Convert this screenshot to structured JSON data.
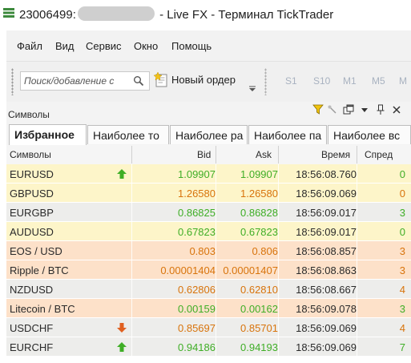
{
  "window": {
    "title_prefix": "23006499:",
    "title_suffix": "- Live FX - Терминал TickTrader"
  },
  "menu": [
    "Файл",
    "Вид",
    "Сервис",
    "Окно",
    "Помощь"
  ],
  "toolbar": {
    "search_placeholder": "Поиск/добавление с",
    "new_order_label": "Новый ордер",
    "timeframes": [
      "S1",
      "S10",
      "M1",
      "M5",
      "M"
    ]
  },
  "panel": {
    "title": "Символы"
  },
  "tabs": [
    "Избранное",
    "Наиболее то",
    "Наиболее ра",
    "Наиболее па",
    "Наиболее вс"
  ],
  "columns": {
    "symbol": "Символы",
    "bid": "Bid",
    "ask": "Ask",
    "time": "Время",
    "spread": "Спред"
  },
  "colors": {
    "row_yellow": "#fdf5c9",
    "row_orange": "#fde1c9",
    "row_gray": "#ededeb",
    "green": "#3fae26",
    "orange": "#d8740c",
    "up_arrow": "#3fae26",
    "down_arrow": "#e06020"
  },
  "rows": [
    {
      "symbol": "EURUSD",
      "bid": "1.09907",
      "ask": "1.09907",
      "time": "18:56:08.760",
      "spread": "0",
      "bg": "yellow",
      "tone": "green",
      "arrow": "up"
    },
    {
      "symbol": "GBPUSD",
      "bid": "1.26580",
      "ask": "1.26580",
      "time": "18:56:09.069",
      "spread": "0",
      "bg": "yellow",
      "tone": "orange",
      "arrow": ""
    },
    {
      "symbol": "EURGBP",
      "bid": "0.86825",
      "ask": "0.86828",
      "time": "18:56:09.017",
      "spread": "3",
      "bg": "gray",
      "tone": "green",
      "arrow": ""
    },
    {
      "symbol": "AUDUSD",
      "bid": "0.67823",
      "ask": "0.67823",
      "time": "18:56:09.017",
      "spread": "0",
      "bg": "yellow",
      "tone": "green",
      "arrow": ""
    },
    {
      "symbol": "EOS / USD",
      "bid": "0.803",
      "ask": "0.806",
      "time": "18:56:08.857",
      "spread": "3",
      "bg": "orange",
      "tone": "orange",
      "arrow": ""
    },
    {
      "symbol": "Ripple / BTC",
      "bid": "0.00001404",
      "ask": "0.00001407",
      "time": "18:56:08.863",
      "spread": "3",
      "bg": "orange",
      "tone": "orange",
      "arrow": ""
    },
    {
      "symbol": "NZDUSD",
      "bid": "0.62806",
      "ask": "0.62810",
      "time": "18:56:08.667",
      "spread": "4",
      "bg": "gray",
      "tone": "orange",
      "arrow": ""
    },
    {
      "symbol": "Litecoin / BTC",
      "bid": "0.00159",
      "ask": "0.00162",
      "time": "18:56:09.078",
      "spread": "3",
      "bg": "orange",
      "tone": "green",
      "arrow": ""
    },
    {
      "symbol": "USDCHF",
      "bid": "0.85697",
      "ask": "0.85701",
      "time": "18:56:09.069",
      "spread": "4",
      "bg": "gray",
      "tone": "orange",
      "arrow": "down"
    },
    {
      "symbol": "EURCHF",
      "bid": "0.94186",
      "ask": "0.94193",
      "time": "18:56:09.069",
      "spread": "7",
      "bg": "gray",
      "tone": "green",
      "arrow": "up"
    }
  ]
}
